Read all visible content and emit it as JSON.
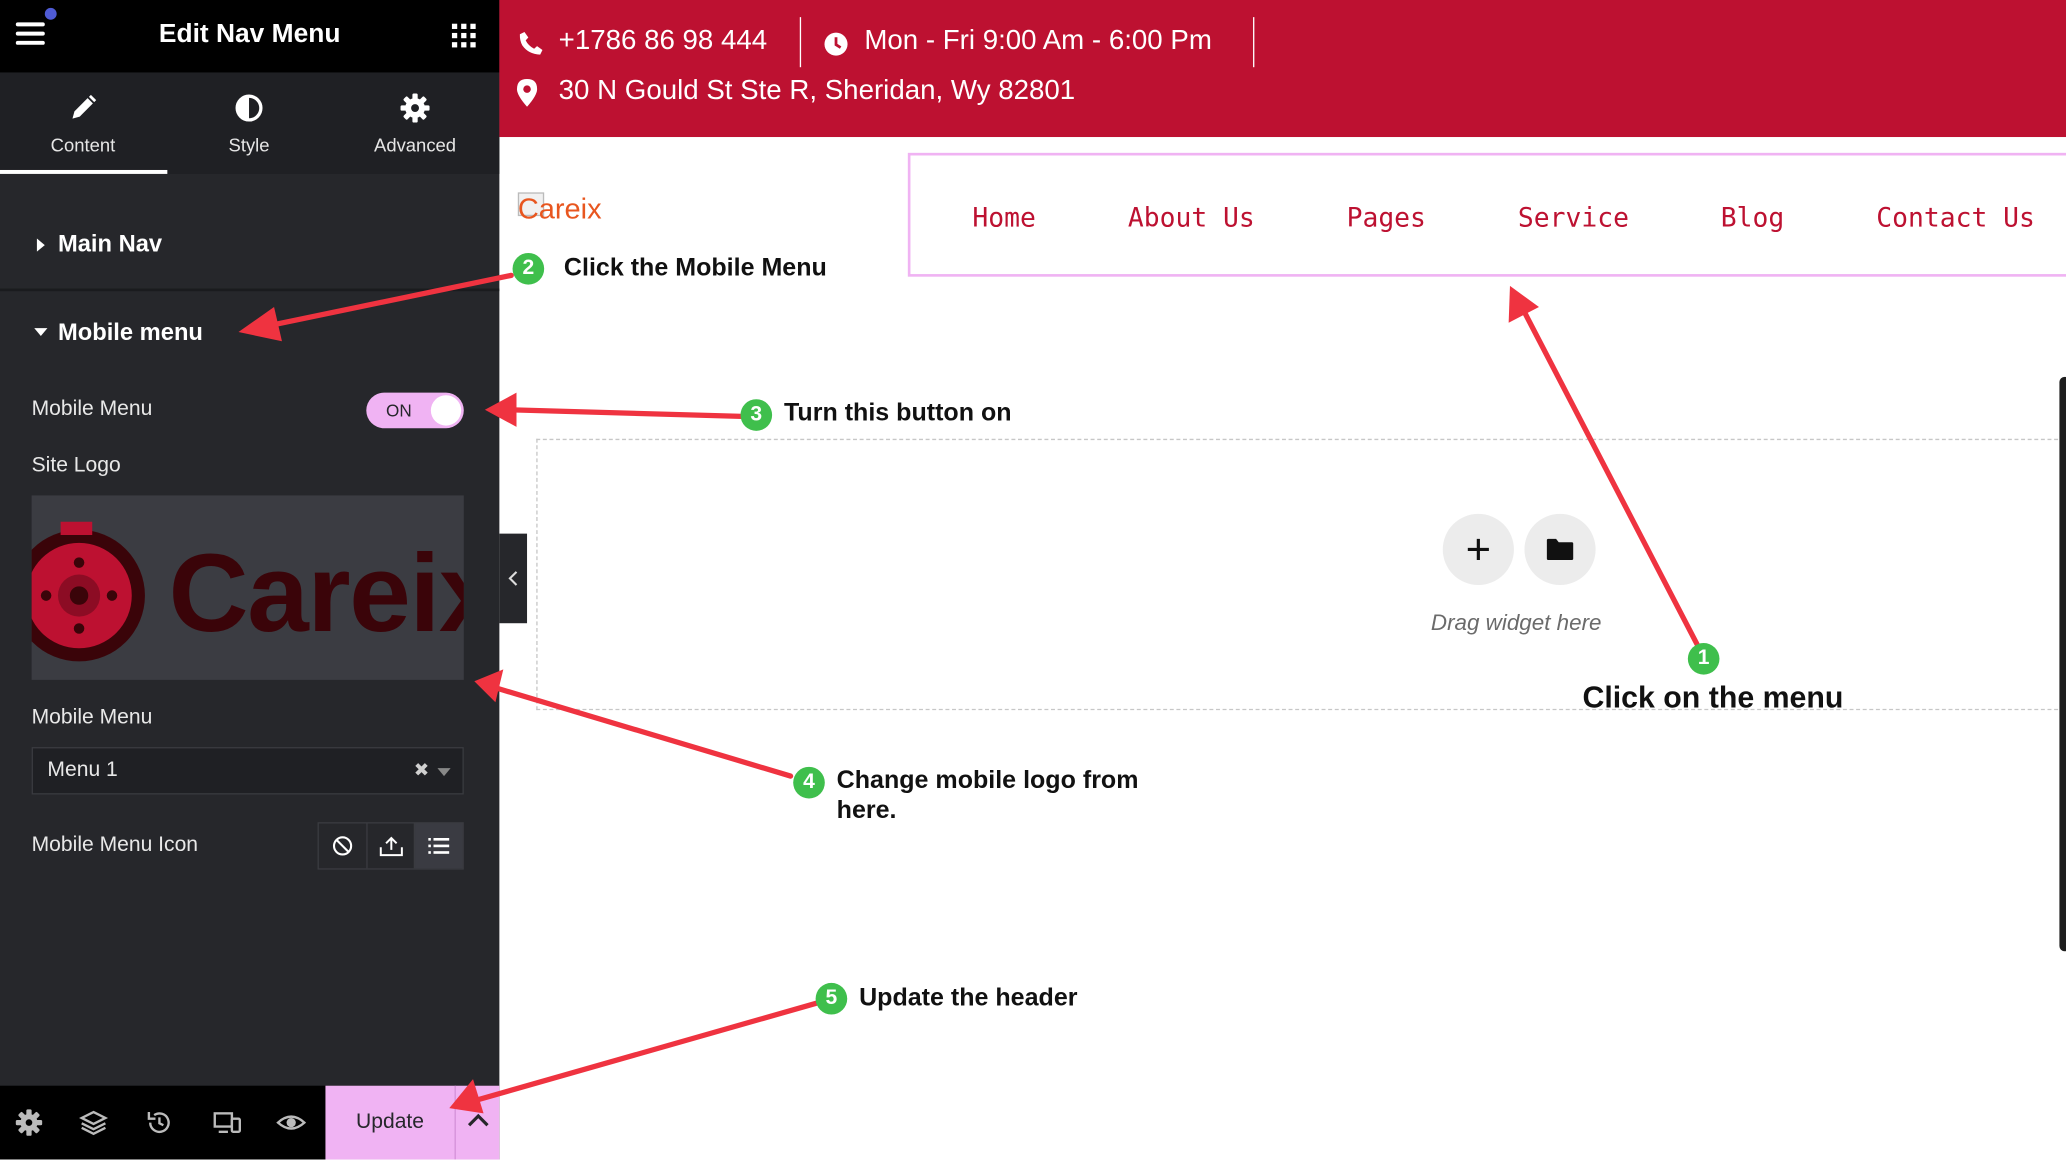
{
  "panel": {
    "title": "Edit Nav Menu",
    "tabs": [
      {
        "label": "Content",
        "icon": "pencil-icon",
        "active": true
      },
      {
        "label": "Style",
        "icon": "half-circle-icon",
        "active": false
      },
      {
        "label": "Advanced",
        "icon": "gear-icon",
        "active": false
      }
    ],
    "sections": {
      "main_nav": "Main Nav",
      "mobile_menu": "Mobile menu"
    },
    "fields": {
      "mobile_menu_toggle_label": "Mobile Menu",
      "toggle_state": "ON",
      "site_logo_label": "Site Logo",
      "logo_preview_text": "Careix",
      "mobile_menu_select_label": "Mobile Menu",
      "mobile_menu_select_value": "Menu 1",
      "mobile_menu_icon_label": "Mobile Menu Icon",
      "icon_choices": [
        "ban-icon",
        "upload-icon",
        "list-icon"
      ]
    },
    "footer": {
      "icons": [
        "settings-icon",
        "layers-icon",
        "history-icon",
        "responsive-icon",
        "eye-icon"
      ],
      "update_label": "Update"
    }
  },
  "site": {
    "topbar": {
      "phone": "+1786 86 98 444",
      "hours": "Mon - Fri 9:00 Am - 6:00 Pm",
      "address": "30 N Gould St Ste R, Sheridan, Wy 82801"
    },
    "brand": "Careix",
    "nav": [
      "Home",
      "About Us",
      "Pages",
      "Service",
      "Blog",
      "Contact Us"
    ],
    "drop_zone": {
      "text": "Drag widget here"
    }
  },
  "annotations": [
    {
      "num": "1",
      "text": "Click on the menu"
    },
    {
      "num": "2",
      "text": "Click the Mobile Menu"
    },
    {
      "num": "3",
      "text": "Turn this button on"
    },
    {
      "num": "4",
      "text": "Change mobile logo from here."
    },
    {
      "num": "5",
      "text": "Update the header"
    }
  ],
  "colors": {
    "panel_bg": "#26272b",
    "accent_pink": "#f0b3f3",
    "brand_red": "#bd1131",
    "annotation_arrow": "#ef3340",
    "badge_green": "#3fbf4c"
  }
}
